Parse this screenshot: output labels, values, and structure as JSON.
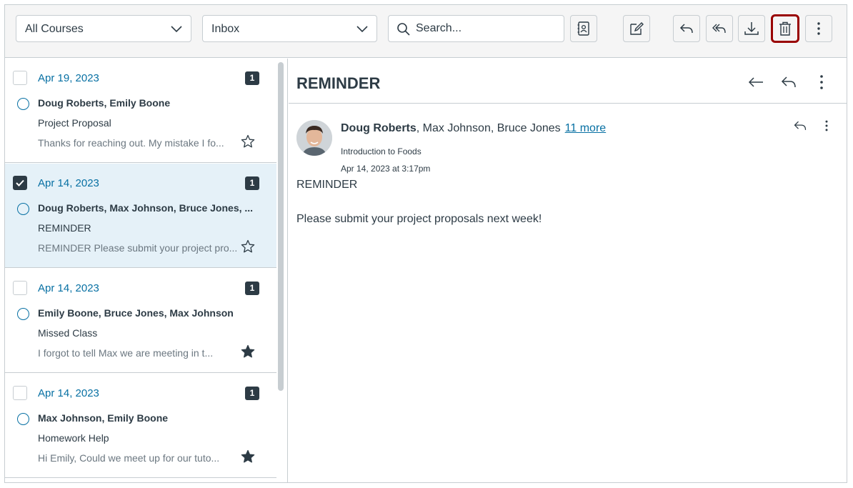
{
  "toolbar": {
    "course_select": "All Courses",
    "mailbox_select": "Inbox",
    "search_placeholder": "Search..."
  },
  "messages": [
    {
      "date": "Apr 19, 2023",
      "count": "1",
      "participants": "Doug Roberts, Emily Boone",
      "subject": "Project Proposal",
      "preview": "Thanks for reaching out. My mistake I fo...",
      "starred": false,
      "checked": false,
      "selected": false
    },
    {
      "date": "Apr 14, 2023",
      "count": "1",
      "participants": "Doug Roberts, Max Johnson, Bruce Jones, ...",
      "subject": "REMINDER",
      "preview": "REMINDER Please submit your project pro...",
      "starred": false,
      "checked": true,
      "selected": true
    },
    {
      "date": "Apr 14, 2023",
      "count": "1",
      "participants": "Emily Boone, Bruce Jones, Max Johnson",
      "subject": "Missed Class",
      "preview": "I forgot to tell Max we are meeting in t...",
      "starred": true,
      "checked": false,
      "selected": false
    },
    {
      "date": "Apr 14, 2023",
      "count": "1",
      "participants": "Max Johnson, Emily Boone",
      "subject": "Homework Help",
      "preview": "Hi Emily, Could we meet up for our tuto...",
      "starred": true,
      "checked": false,
      "selected": false
    }
  ],
  "conversation": {
    "title": "REMINDER",
    "sender": "Doug Roberts",
    "recipients": ", Max Johnson, Bruce Jones",
    "more_link": "11 more",
    "course": "Introduction to Foods",
    "sent_at": "Apr 14, 2023 at 3:17pm",
    "subject": "REMINDER",
    "body": "Please submit your project proposals next week!"
  },
  "colors": {
    "accent": "#0770a3",
    "text": "#2d3b45",
    "highlight": "#990000",
    "selected_row": "#e5f1f8"
  }
}
